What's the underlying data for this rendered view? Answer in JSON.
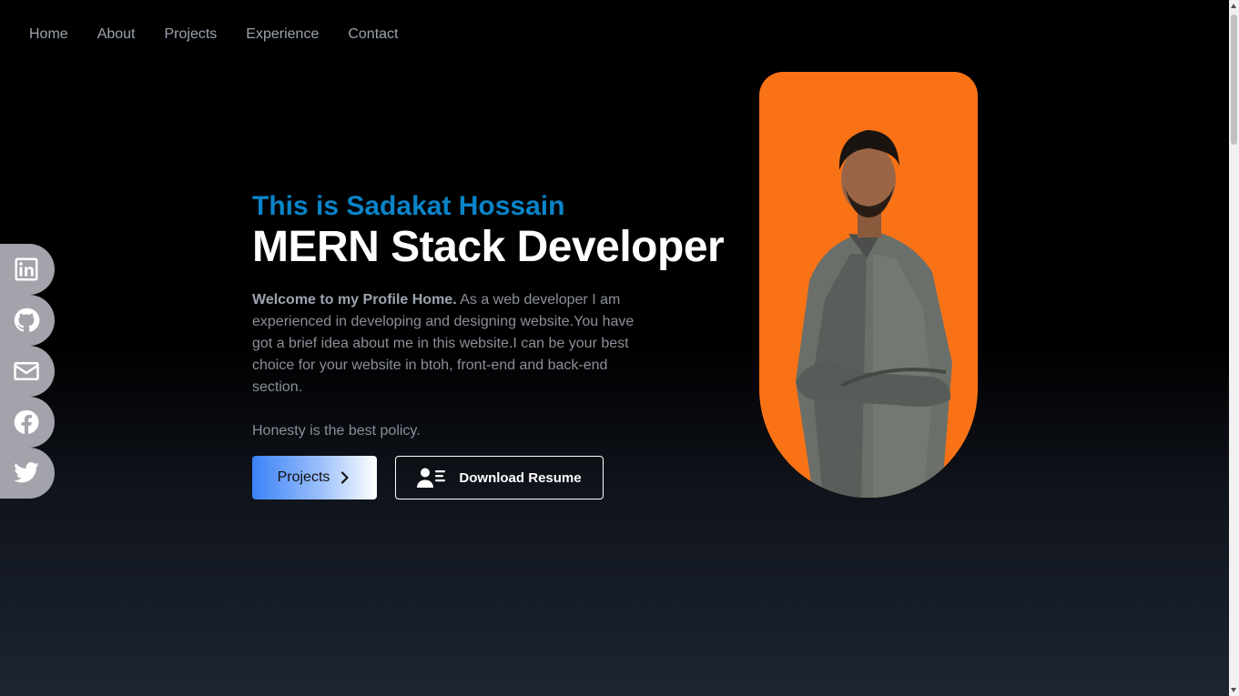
{
  "nav": {
    "items": [
      {
        "label": "Home"
      },
      {
        "label": "About"
      },
      {
        "label": "Projects"
      },
      {
        "label": "Experience"
      },
      {
        "label": "Contact"
      }
    ]
  },
  "social": {
    "icons": [
      "linkedin-icon",
      "github-icon",
      "mail-icon",
      "facebook-icon",
      "twitter-icon"
    ]
  },
  "hero": {
    "intro": "This is Sadakat Hossain",
    "title": "MERN Stack Developer",
    "desc_bold": "Welcome to my Profile Home.",
    "desc_text": " As a web developer I am experienced in developing and designing website.You have got a brief idea about me in this website.I can be your best choice for your website in btoh, front-end and back-end section.",
    "motto": "Honesty is the best policy."
  },
  "buttons": {
    "projects_label": "Projects",
    "resume_label": "Download Resume"
  },
  "colors": {
    "accent_blue": "#0a84c8",
    "portrait_bg": "#f97316",
    "social_bg": "#a3a3ab"
  }
}
